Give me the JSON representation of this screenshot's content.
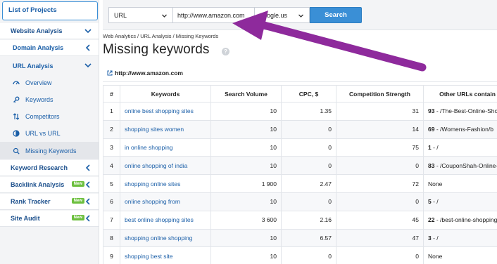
{
  "sidebar": {
    "projects_label": "List of Projects",
    "items": [
      {
        "label": "Website Analysis"
      },
      {
        "label": "Domain Analysis"
      },
      {
        "label": "URL Analysis"
      },
      {
        "label": "Overview"
      },
      {
        "label": "Keywords"
      },
      {
        "label": "Competitors"
      },
      {
        "label": "URL vs URL"
      },
      {
        "label": "Missing Keywords"
      },
      {
        "label": "Keyword Research"
      },
      {
        "label": "Backlink Analysis",
        "badge": "New"
      },
      {
        "label": "Rank Tracker",
        "badge": "New"
      },
      {
        "label": "Site Audit",
        "badge": "New"
      }
    ]
  },
  "search": {
    "type_value": "URL",
    "domain_value": "http://www.amazon.com",
    "database_value": "google.us",
    "button_label": "Search"
  },
  "header": {
    "breadcrumb": "Web Analytics / URL Analysis / Missing Keywords",
    "title": "Missing keywords",
    "help": "?",
    "domain": "http://www.amazon.com"
  },
  "table": {
    "columns": [
      "#",
      "Keywords",
      "Search Volume",
      "CPC, $",
      "Competition Strength",
      "Other URLs contain"
    ],
    "rows": [
      {
        "num": "1",
        "keyword": "online best shopping sites",
        "volume": "10",
        "cpc": "1.35",
        "competition": "31",
        "url_count": "93",
        "url_text": " - /The-Best-Online-Shopping-F"
      },
      {
        "num": "2",
        "keyword": "shopping sites women",
        "volume": "10",
        "cpc": "0",
        "competition": "14",
        "url_count": "69",
        "url_text": " - /Womens-Fashion/b"
      },
      {
        "num": "3",
        "keyword": "in online shopping",
        "volume": "10",
        "cpc": "0",
        "competition": "75",
        "url_count": "1",
        "url_text": " - /"
      },
      {
        "num": "4",
        "keyword": "online shopping of india",
        "volume": "10",
        "cpc": "0",
        "competition": "0",
        "url_count": "83",
        "url_text": " - /CouponShah-Online-Shoppi"
      },
      {
        "num": "5",
        "keyword": "shopping online sites",
        "volume": "1 900",
        "cpc": "2.47",
        "competition": "72",
        "url_count": "",
        "url_text": "None"
      },
      {
        "num": "6",
        "keyword": "online shopping from",
        "volume": "10",
        "cpc": "0",
        "competition": "0",
        "url_count": "5",
        "url_text": " - /"
      },
      {
        "num": "7",
        "keyword": "best online shopping sites",
        "volume": "3 600",
        "cpc": "2.16",
        "competition": "45",
        "url_count": "22",
        "url_text": " - /best-online-shopping-websi"
      },
      {
        "num": "8",
        "keyword": "shopping online shopping",
        "volume": "10",
        "cpc": "6.57",
        "competition": "47",
        "url_count": "3",
        "url_text": " - /"
      },
      {
        "num": "9",
        "keyword": "shopping best site",
        "volume": "10",
        "cpc": "0",
        "competition": "0",
        "url_count": "",
        "url_text": "None"
      }
    ]
  },
  "colors": {
    "accent": "#3a8fd6",
    "link": "#1b5fa8",
    "badge_new": "#6cbf3e",
    "annotation_arrow": "#8e2a9c"
  }
}
